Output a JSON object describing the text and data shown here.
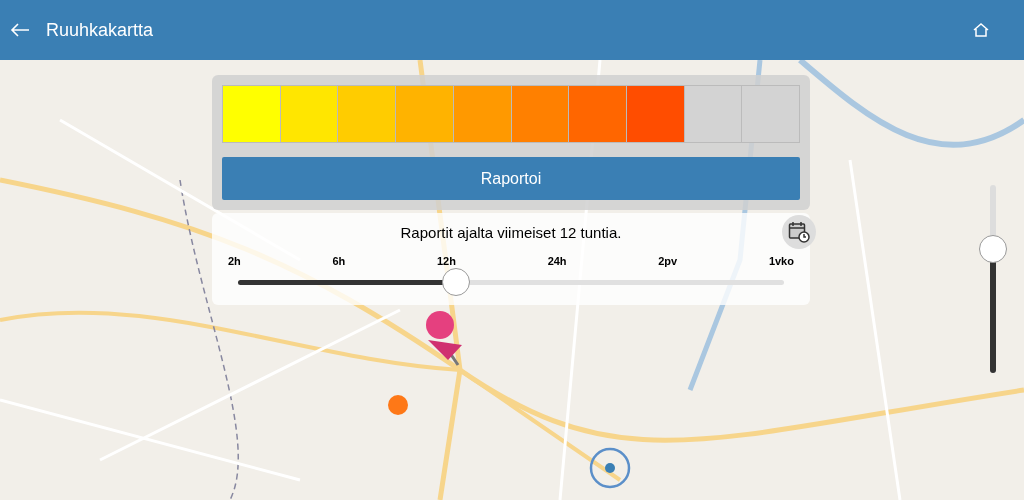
{
  "app_bar": {
    "title": "Ruuhkakartta"
  },
  "scale": [
    {
      "color": "#ffff00"
    },
    {
      "color": "#ffe600"
    },
    {
      "color": "#ffcc00"
    },
    {
      "color": "#ffb300"
    },
    {
      "color": "#ff9900"
    },
    {
      "color": "#ff8000"
    },
    {
      "color": "#ff6600"
    },
    {
      "color": "#ff4d00"
    },
    {
      "color": "#d3d3d3"
    },
    {
      "color": "#d3d3d3"
    }
  ],
  "report_button": "Raportoi",
  "time_panel": {
    "caption": "Raportit ajalta viimeiset 12 tuntia.",
    "ticks": [
      "2h",
      "6h",
      "12h",
      "24h",
      "2pv",
      "1vko"
    ],
    "level": 0.4
  },
  "zoom_slider": {
    "level": 0.66
  }
}
